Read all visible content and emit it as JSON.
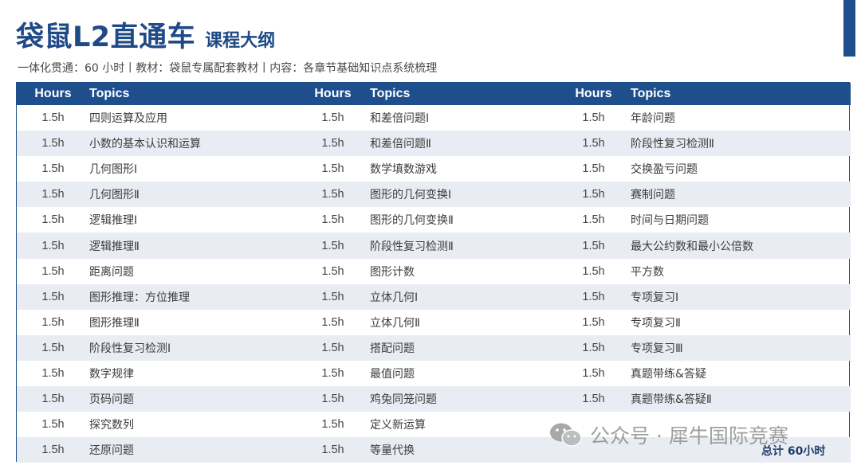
{
  "header": {
    "title": "袋鼠L2直通车",
    "title_suffix": "课程大纲",
    "subtitle": "一体化贯通：60 小时丨教材：袋鼠专属配套教材丨内容：各章节基础知识点系统梳理"
  },
  "table": {
    "columns": [
      "Hours",
      "Topics",
      "Hours",
      "Topics",
      "Hours",
      "Topics"
    ],
    "rows": [
      [
        "1.5h",
        "四则运算及应用",
        "1.5h",
        "和差倍问题Ⅰ",
        "1.5h",
        "年龄问题"
      ],
      [
        "1.5h",
        "小数的基本认识和运算",
        "1.5h",
        "和差倍问题Ⅱ",
        "1.5h",
        "阶段性复习检测Ⅱ"
      ],
      [
        "1.5h",
        "几何图形Ⅰ",
        "1.5h",
        "数学填数游戏",
        "1.5h",
        "交换盈亏问题"
      ],
      [
        "1.5h",
        "几何图形Ⅱ",
        "1.5h",
        "图形的几何变换Ⅰ",
        "1.5h",
        "赛制问题"
      ],
      [
        "1.5h",
        "逻辑推理Ⅰ",
        "1.5h",
        "图形的几何变换Ⅱ",
        "1.5h",
        "时间与日期问题"
      ],
      [
        "1.5h",
        "逻辑推理Ⅱ",
        "1.5h",
        "阶段性复习检测Ⅱ",
        "1.5h",
        "最大公约数和最小公倍数"
      ],
      [
        "1.5h",
        "距离问题",
        "1.5h",
        "图形计数",
        "1.5h",
        "平方数"
      ],
      [
        "1.5h",
        "图形推理：方位推理",
        "1.5h",
        "立体几何Ⅰ",
        "1.5h",
        "专项复习Ⅰ"
      ],
      [
        "1.5h",
        "图形推理Ⅱ",
        "1.5h",
        "立体几何Ⅱ",
        "1.5h",
        "专项复习Ⅱ"
      ],
      [
        "1.5h",
        "阶段性复习检测Ⅰ",
        "1.5h",
        "搭配问题",
        "1.5h",
        "专项复习Ⅲ"
      ],
      [
        "1.5h",
        "数字规律",
        "1.5h",
        "最值问题",
        "1.5h",
        "真题带练&答疑"
      ],
      [
        "1.5h",
        "页码问题",
        "1.5h",
        "鸡兔同笼问题",
        "1.5h",
        "真题带练&答疑Ⅱ"
      ],
      [
        "1.5h",
        "探究数列",
        "1.5h",
        "定义新运算",
        "",
        ""
      ],
      [
        "1.5h",
        "还原问题",
        "1.5h",
        "等量代换",
        "",
        ""
      ]
    ]
  },
  "total": "总计 60小时",
  "watermark": "公众号 · 犀牛国际竞赛",
  "colors": {
    "brand_blue": "#1e4e8c",
    "stripe": "#e9edf3"
  }
}
